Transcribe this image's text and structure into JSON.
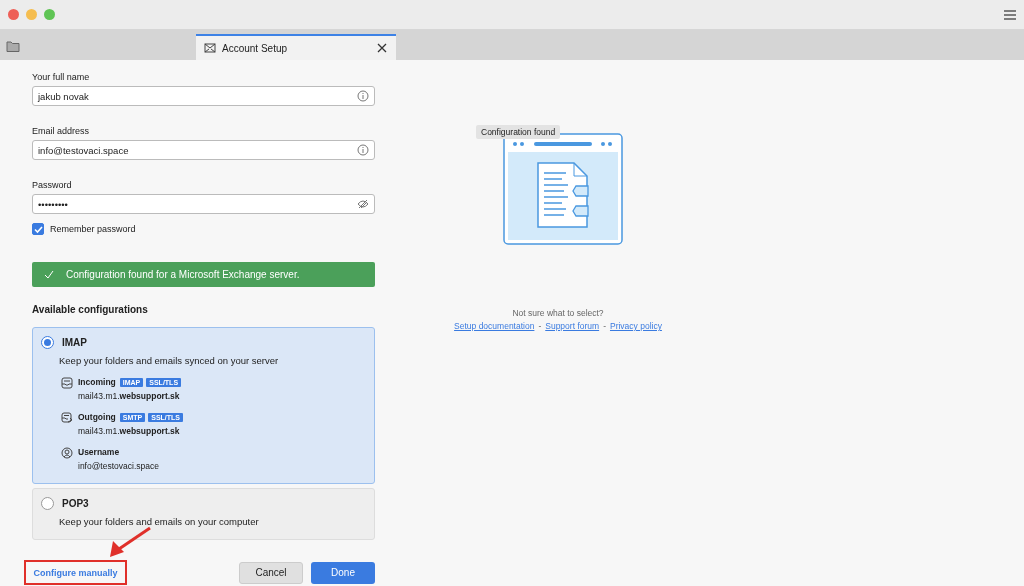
{
  "tab": {
    "title": "Account Setup",
    "selected": true
  },
  "form": {
    "fields": [
      {
        "label": "Your full name",
        "value": "jakub novak",
        "kind": "text"
      },
      {
        "label": "Email address",
        "value": "info@testovaci.space",
        "kind": "text"
      },
      {
        "label": "Password",
        "value": "•••••••••",
        "kind": "password"
      }
    ],
    "remember_password": {
      "label": "Remember password",
      "checked": true
    },
    "banner": "Configuration found for a Microsoft Exchange server.",
    "configs_heading": "Available configurations",
    "configurations": [
      {
        "name": "IMAP",
        "description": "Keep your folders and emails synced on your server",
        "selected": true,
        "servers": [
          {
            "kind": "incoming",
            "label": "Incoming",
            "tags": [
              "IMAP",
              "SSL/TLS"
            ],
            "value": "mail43.m1.**websupport.sk**"
          },
          {
            "kind": "outgoing",
            "label": "Outgoing",
            "tags": [
              "SMTP",
              "SSL/TLS"
            ],
            "value": "mail43.m1.**websupport.sk**"
          },
          {
            "kind": "user",
            "label": "Username",
            "value": "info@testovaci.space"
          }
        ]
      },
      {
        "name": "POP3",
        "description": "Keep your folders and emails on your computer",
        "selected": false
      }
    ],
    "link": "Configure manually",
    "buttons": [
      {
        "label": "Cancel",
        "kind": "secondary"
      },
      {
        "label": "Done",
        "kind": "primary"
      }
    ]
  },
  "help": {
    "badge": "Configuration found",
    "question": "Not sure what to select?",
    "separator": "-",
    "links": [
      "Setup documentation",
      "Support forum",
      "Privacy policy"
    ]
  }
}
